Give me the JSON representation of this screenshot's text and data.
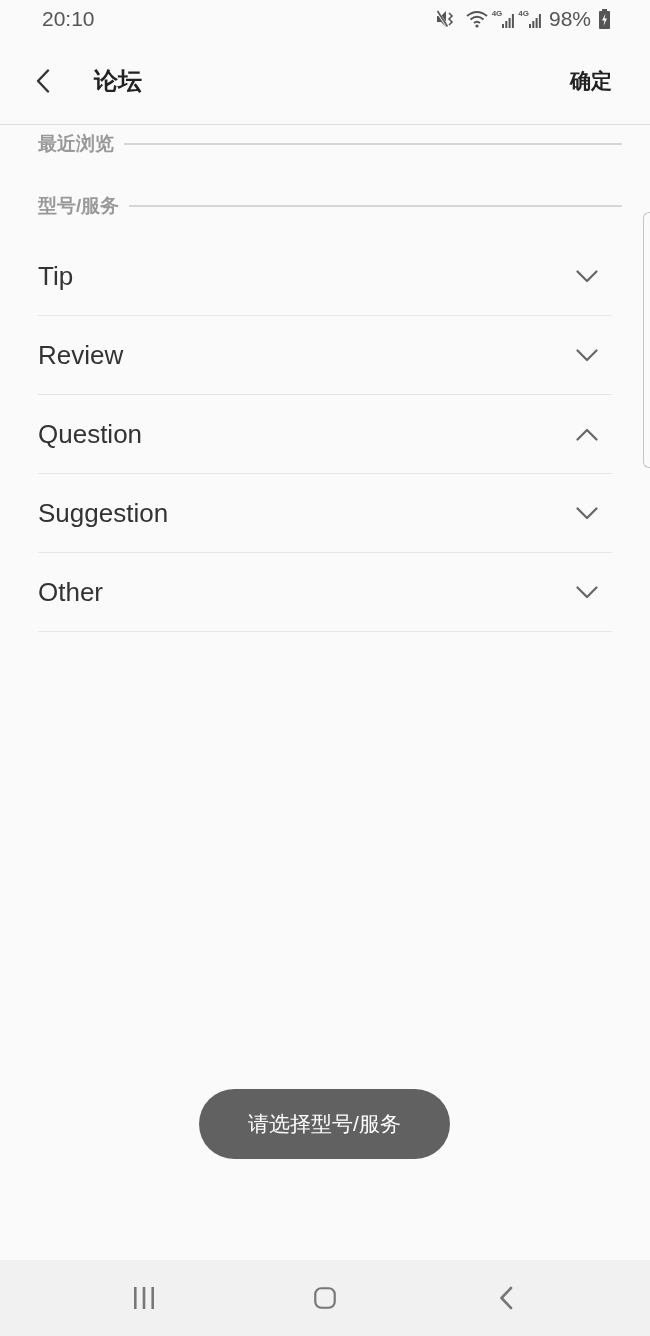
{
  "status_bar": {
    "time": "20:10",
    "networks": [
      {
        "label": "4G"
      },
      {
        "label": "4G"
      }
    ],
    "battery": "98%"
  },
  "header": {
    "title": "论坛",
    "confirm": "确定"
  },
  "sections": [
    {
      "title": "最近浏览"
    },
    {
      "title": "型号/服务",
      "items": [
        {
          "label": "Tip",
          "expanded": false
        },
        {
          "label": "Review",
          "expanded": false
        },
        {
          "label": "Question",
          "expanded": true
        },
        {
          "label": "Suggestion",
          "expanded": false
        },
        {
          "label": "Other",
          "expanded": false
        }
      ]
    }
  ],
  "toast": {
    "text": "请选择型号/服务"
  }
}
